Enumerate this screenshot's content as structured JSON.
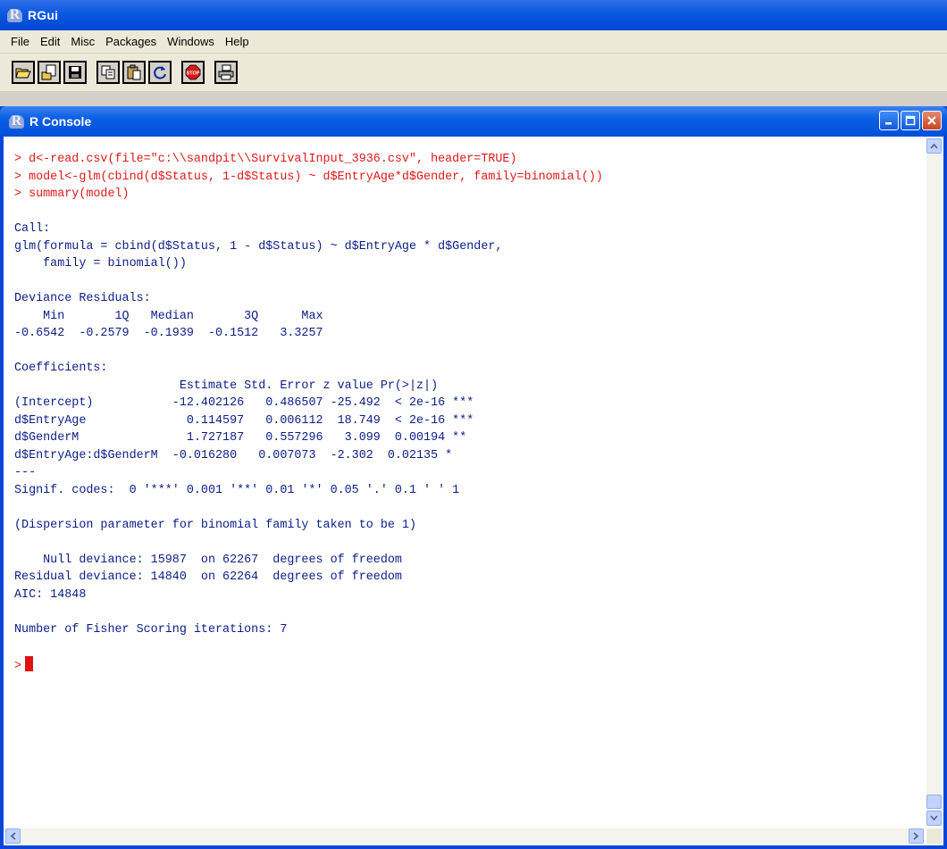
{
  "app": {
    "title": "RGui"
  },
  "menu": [
    "File",
    "Edit",
    "Misc",
    "Packages",
    "Windows",
    "Help"
  ],
  "toolbar": {
    "buttons": [
      "open-script-icon",
      "load-workspace-icon",
      "save-workspace-icon",
      "copy-icon",
      "paste-icon",
      "refresh-icon",
      "stop-icon",
      "print-icon"
    ],
    "stop_label": "STOP"
  },
  "console": {
    "title": "R Console",
    "lines": [
      {
        "type": "input",
        "text": "> d<-read.csv(file=\"c:\\\\sandpit\\\\SurvivalInput_3936.csv\", header=TRUE)"
      },
      {
        "type": "input",
        "text": "> model<-glm(cbind(d$Status, 1-d$Status) ~ d$EntryAge*d$Gender, family=binomial())"
      },
      {
        "type": "input",
        "text": "> summary(model)"
      },
      {
        "type": "output",
        "text": ""
      },
      {
        "type": "output",
        "text": "Call:"
      },
      {
        "type": "output",
        "text": "glm(formula = cbind(d$Status, 1 - d$Status) ~ d$EntryAge * d$Gender,"
      },
      {
        "type": "output",
        "text": "    family = binomial())"
      },
      {
        "type": "output",
        "text": ""
      },
      {
        "type": "output",
        "text": "Deviance Residuals:"
      },
      {
        "type": "output",
        "text": "    Min       1Q   Median       3Q      Max"
      },
      {
        "type": "output",
        "text": "-0.6542  -0.2579  -0.1939  -0.1512   3.3257"
      },
      {
        "type": "output",
        "text": ""
      },
      {
        "type": "output",
        "text": "Coefficients:"
      },
      {
        "type": "output",
        "text": "                       Estimate Std. Error z value Pr(>|z|)"
      },
      {
        "type": "output",
        "text": "(Intercept)           -12.402126   0.486507 -25.492  < 2e-16 ***"
      },
      {
        "type": "output",
        "text": "d$EntryAge              0.114597   0.006112  18.749  < 2e-16 ***"
      },
      {
        "type": "output",
        "text": "d$GenderM               1.727187   0.557296   3.099  0.00194 **"
      },
      {
        "type": "output",
        "text": "d$EntryAge:d$GenderM  -0.016280   0.007073  -2.302  0.02135 *"
      },
      {
        "type": "output",
        "text": "---"
      },
      {
        "type": "output",
        "text": "Signif. codes:  0 '***' 0.001 '**' 0.01 '*' 0.05 '.' 0.1 ' ' 1"
      },
      {
        "type": "output",
        "text": ""
      },
      {
        "type": "output",
        "text": "(Dispersion parameter for binomial family taken to be 1)"
      },
      {
        "type": "output",
        "text": ""
      },
      {
        "type": "output",
        "text": "    Null deviance: 15987  on 62267  degrees of freedom"
      },
      {
        "type": "output",
        "text": "Residual deviance: 14840  on 62264  degrees of freedom"
      },
      {
        "type": "output",
        "text": "AIC: 14848"
      },
      {
        "type": "output",
        "text": ""
      },
      {
        "type": "output",
        "text": "Number of Fisher Scoring iterations: 7"
      },
      {
        "type": "output",
        "text": ""
      }
    ],
    "prompt": ">"
  },
  "colors": {
    "input": "#e01818",
    "output": "#0c1d87",
    "cursor": "#e01010"
  }
}
